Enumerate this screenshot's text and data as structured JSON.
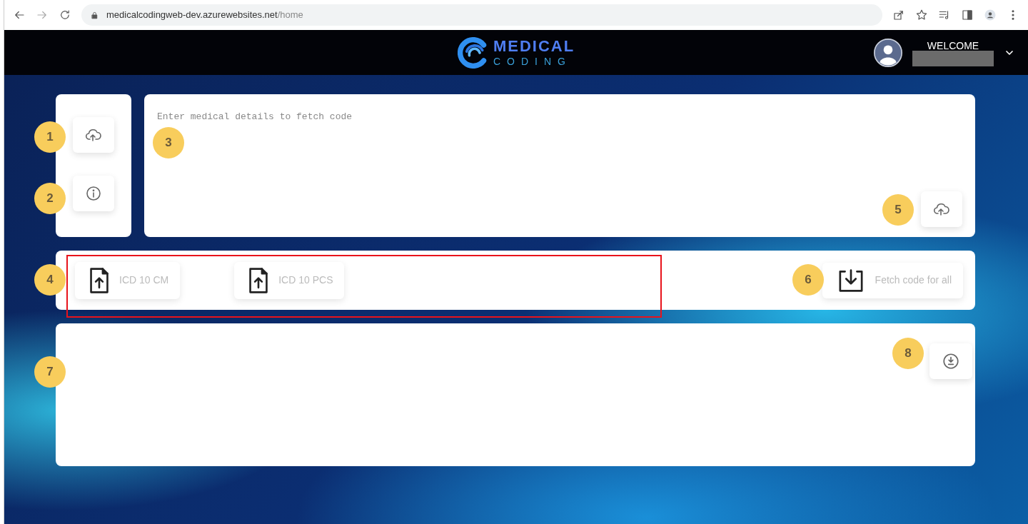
{
  "browser": {
    "url_host": "medicalcodingweb-dev.azurewebsites.net",
    "url_path": "/home"
  },
  "header": {
    "logo_top": "MEDICAL",
    "logo_bottom": "CODING",
    "welcome": "WELCOME",
    "name_hidden": true
  },
  "side_buttons": [
    {
      "kind": "upload",
      "callout": "1"
    },
    {
      "kind": "info",
      "callout": "2"
    }
  ],
  "input": {
    "placeholder": "Enter medical details to fetch code",
    "callout": "3",
    "submit_callout": "5"
  },
  "toolbar": {
    "callout": "4",
    "highlighted": true,
    "uploads": [
      {
        "label": "ICD 10 CM"
      },
      {
        "label": "ICD 10 PCS"
      }
    ],
    "fetch": {
      "label": "Fetch code for all",
      "callout": "6"
    }
  },
  "results": {
    "callout": "7",
    "download_callout": "8"
  }
}
